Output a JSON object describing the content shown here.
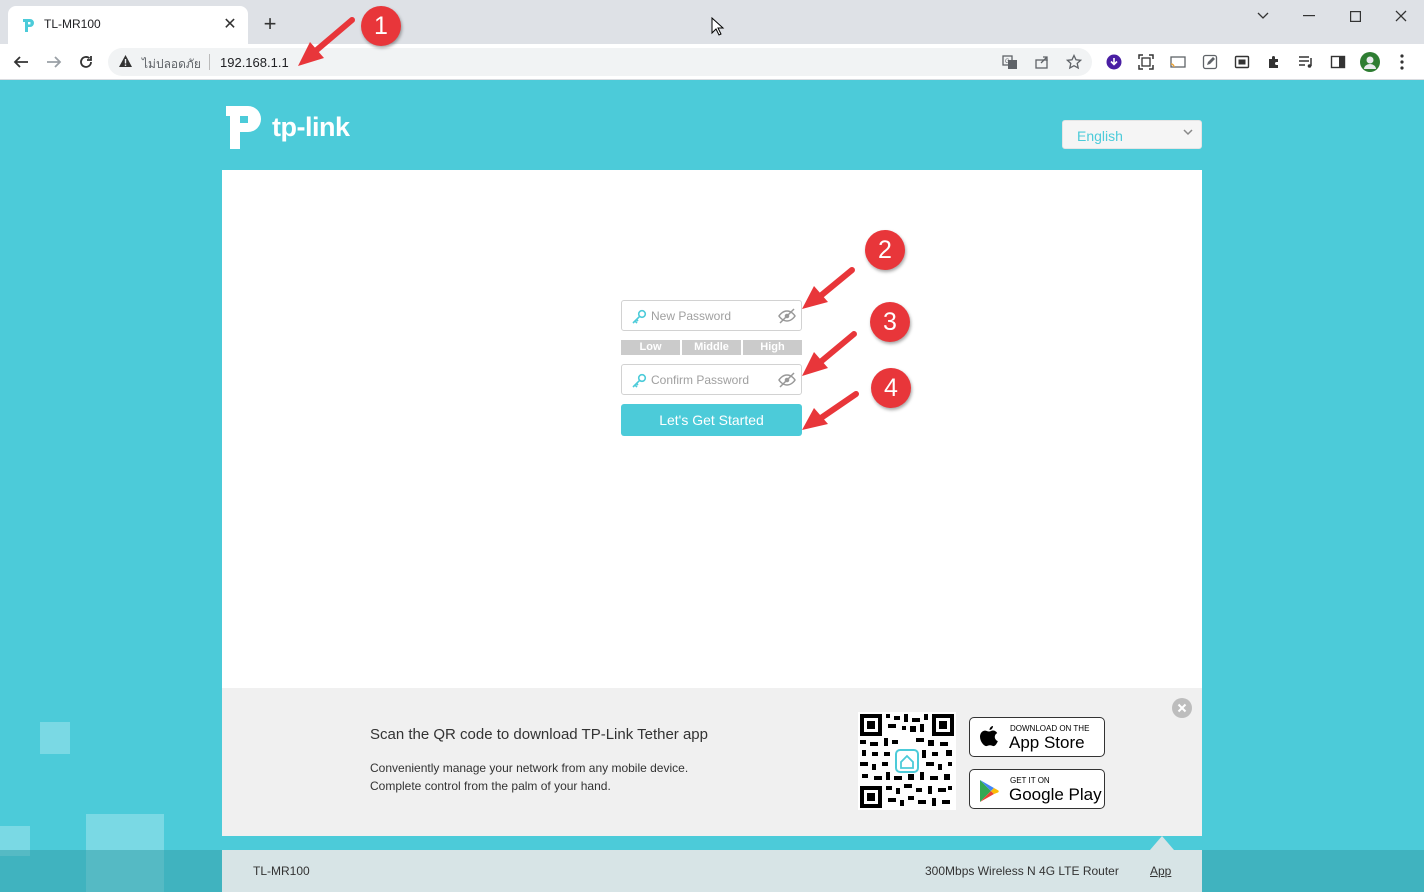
{
  "browser": {
    "tab_title": "TL-MR100",
    "insecure_label": "ไม่ปลอดภัย",
    "url": "192.168.1.1"
  },
  "page": {
    "brand": "tp-link",
    "language": "English",
    "new_password_placeholder": "New Password",
    "confirm_password_placeholder": "Confirm Password",
    "strength_levels": [
      "Low",
      "Middle",
      "High"
    ],
    "start_button": "Let's Get Started"
  },
  "annotations": [
    "1",
    "2",
    "3",
    "4"
  ],
  "annotation_color": "#e8363a",
  "promo": {
    "title": "Scan the QR code to download TP-Link Tether app",
    "line1": "Conveniently manage your network from any mobile device.",
    "line2": "Complete control from the palm of your hand.",
    "appstore_small": "DOWNLOAD ON THE",
    "appstore_big": "App Store",
    "googleplay_small": "GET IT ON",
    "googleplay_big": "Google Play"
  },
  "footer": {
    "model": "TL-MR100",
    "description": "300Mbps Wireless N 4G LTE Router",
    "app_link": "App"
  },
  "colors": {
    "brand_teal": "#4ccbd9",
    "card": "#ffffff",
    "promo_bg": "#f0f0f0"
  }
}
